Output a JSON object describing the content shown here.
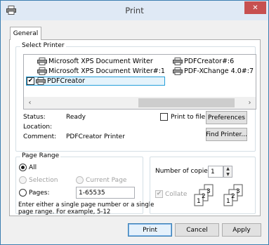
{
  "window": {
    "title": "Print",
    "close_glyph": "✕"
  },
  "tabs": [
    {
      "label": "General"
    }
  ],
  "select_printer": {
    "legend": "Select Printer",
    "printers": [
      {
        "name": "Microsoft XPS Document Writer",
        "icon": "printer-icon"
      },
      {
        "name": "Microsoft XPS Document Writer#:1",
        "icon": "printer-icon"
      },
      {
        "name": "PDFCreator",
        "icon": "printer-icon",
        "selected": true,
        "default": true
      },
      {
        "name": "PDFCreator#:6",
        "icon": "printer-icon"
      },
      {
        "name": "PDF-XChange 4.0#:7",
        "icon": "printer-icon"
      }
    ],
    "scroll": {
      "left": "‹",
      "right": "›"
    },
    "status_label": "Status:",
    "status_value": "Ready",
    "location_label": "Location:",
    "location_value": "",
    "comment_label": "Comment:",
    "comment_value": "PDFCreator Printer",
    "print_to_file_label": "Print to file",
    "preferences_label": "Preferences",
    "find_printer_label": "Find Printer..."
  },
  "page_range": {
    "legend": "Page Range",
    "all_label": "All",
    "selection_label": "Selection",
    "current_page_label": "Current Page",
    "pages_label": "Pages:",
    "pages_value": "1-65535",
    "help_text_1": "Enter either a single page number or a single",
    "help_text_2": "page range.  For example, 5-12"
  },
  "copies": {
    "number_label": "Number of copies:",
    "number_value": "1",
    "collate_label": "Collate",
    "collate_checked": true,
    "page_numbers": [
      "1",
      "2",
      "3"
    ]
  },
  "buttons": {
    "print": "Print",
    "cancel": "Cancel",
    "apply": "Apply"
  },
  "colors": {
    "accent": "#3c7fb1",
    "close": "#c75050",
    "selection": "#e5f3fb"
  }
}
